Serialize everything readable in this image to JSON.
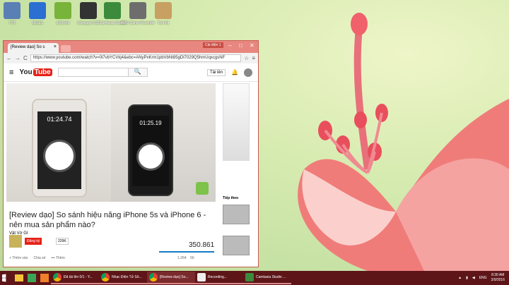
{
  "desktop": {
    "icons": [
      {
        "label": "! P9",
        "color": "#5a7fb5"
      },
      {
        "label": "UltraIS",
        "color": "#2a6fd1"
      },
      {
        "label": "uTorrent",
        "color": "#78b33a"
      },
      {
        "label": "Inkscape 0.92",
        "color": "#333"
      },
      {
        "label": "Camtasia Studio",
        "color": "#3d8a3d"
      },
      {
        "label": "AMD Game Recorder",
        "color": "#6d6d6d"
      },
      {
        "label": "Tool Kit",
        "color": "#c8a062"
      }
    ]
  },
  "browser": {
    "tab_title": "[Review dạo] So s",
    "tab_close": "×",
    "user_badge": "Cái điện 1",
    "win_min": "–",
    "win_max": "□",
    "win_close": "✕",
    "back": "←",
    "forward": "→",
    "reload": "C",
    "url": "https://www.youtube.com/watch?v=0l7vbYCVkj4&ebc=ANyPxKrm1pbVbNt85gDl7029Q5hmUqxcgsNF",
    "star": "☆",
    "menu": "≡"
  },
  "youtube": {
    "logo_you": "You",
    "logo_tube": "Tube",
    "search_placeholder": "",
    "search_icon": "🔍",
    "upload": "Tải lên",
    "bell": "🔔",
    "menu_icon": "≡",
    "phone_left_time": "01:24.74",
    "phone_right_time": "01:25.19",
    "video_title": "[Review dạo] So sánh hiệu năng iPhone 5s và iPhone 6 - nên mua sản phẩm nào?",
    "channel": "Vật Vờ GI",
    "subscribe": "Đăng ký",
    "sub_count": "229K",
    "views": "350.861",
    "add_to": "+ Thêm vào",
    "share": "Chia sẻ",
    "more": "••• Thêm",
    "likes": "1.264",
    "dislikes": "56",
    "next_label": "Tiếp theo"
  },
  "taskbar": {
    "items": [
      {
        "label": "Đã tải lên 0/1 - Y...",
        "color": "#e14b3b"
      },
      {
        "label": "Nhạc Điện Tử Sô...",
        "color": "#e14b3b"
      },
      {
        "label": "[Review dạo] So...",
        "color": "#e14b3b"
      },
      {
        "label": "Recording...",
        "color": "#eee"
      },
      {
        "label": "Camtasia Studio ...",
        "color": "#3d8a3d"
      }
    ],
    "lang": "ENG",
    "time": "8:30 AM",
    "date": "3/9/2016"
  }
}
